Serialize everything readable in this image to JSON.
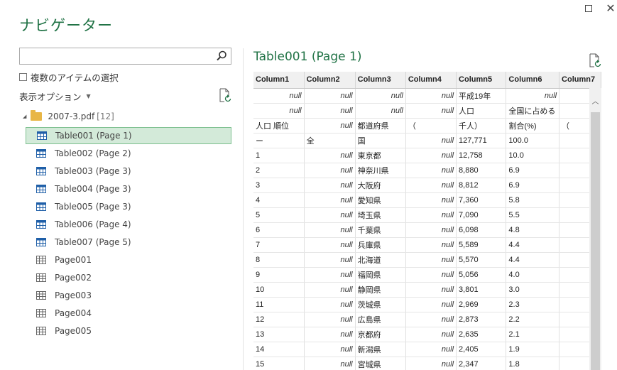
{
  "window": {
    "title": "ナビゲーター",
    "maximize_label": "",
    "close_label": "✕"
  },
  "search": {
    "placeholder": "",
    "value": ""
  },
  "multi_select_label": "複数のアイテムの選択",
  "view_options_label": "表示オプション",
  "tree": {
    "root": {
      "name": "2007-3.pdf",
      "count": "[12]"
    },
    "items": [
      {
        "label": "Table001 (Page 1)",
        "type": "table",
        "selected": true
      },
      {
        "label": "Table002 (Page 2)",
        "type": "table"
      },
      {
        "label": "Table003 (Page 3)",
        "type": "table"
      },
      {
        "label": "Table004 (Page 3)",
        "type": "table"
      },
      {
        "label": "Table005 (Page 3)",
        "type": "table"
      },
      {
        "label": "Table006 (Page 4)",
        "type": "table"
      },
      {
        "label": "Table007 (Page 5)",
        "type": "table"
      },
      {
        "label": "Page001",
        "type": "page"
      },
      {
        "label": "Page002",
        "type": "page"
      },
      {
        "label": "Page003",
        "type": "page"
      },
      {
        "label": "Page004",
        "type": "page"
      },
      {
        "label": "Page005",
        "type": "page"
      }
    ]
  },
  "preview": {
    "title": "Table001 (Page 1)",
    "columns": [
      "Column1",
      "Column2",
      "Column3",
      "Column4",
      "Column5",
      "Column6",
      "Column7"
    ],
    "rows": [
      [
        null,
        null,
        null,
        null,
        "平成19年",
        null,
        ""
      ],
      [
        null,
        null,
        null,
        null,
        "人口",
        "全国に占める",
        ""
      ],
      [
        "人口 順位",
        null,
        "都道府県",
        "（",
        "千人）",
        "割合(%)",
        "（"
      ],
      [
        "ー",
        "全",
        "国",
        null,
        "127,771",
        "100.0",
        ""
      ],
      [
        "1",
        null,
        "東京都",
        null,
        "12,758",
        "10.0",
        ""
      ],
      [
        "2",
        null,
        "神奈川県",
        null,
        "8,880",
        "6.9",
        ""
      ],
      [
        "3",
        null,
        "大阪府",
        null,
        "8,812",
        "6.9",
        ""
      ],
      [
        "4",
        null,
        "愛知県",
        null,
        "7,360",
        "5.8",
        ""
      ],
      [
        "5",
        null,
        "埼玉県",
        null,
        "7,090",
        "5.5",
        ""
      ],
      [
        "6",
        null,
        "千葉県",
        null,
        "6,098",
        "4.8",
        ""
      ],
      [
        "7",
        null,
        "兵庫県",
        null,
        "5,589",
        "4.4",
        ""
      ],
      [
        "8",
        null,
        "北海道",
        null,
        "5,570",
        "4.4",
        ""
      ],
      [
        "9",
        null,
        "福岡県",
        null,
        "5,056",
        "4.0",
        ""
      ],
      [
        "10",
        null,
        "静岡県",
        null,
        "3,801",
        "3.0",
        ""
      ],
      [
        "11",
        null,
        "茨城県",
        null,
        "2,969",
        "2.3",
        ""
      ],
      [
        "12",
        null,
        "広島県",
        null,
        "2,873",
        "2.2",
        ""
      ],
      [
        "13",
        null,
        "京都府",
        null,
        "2,635",
        "2.1",
        ""
      ],
      [
        "14",
        null,
        "新潟県",
        null,
        "2,405",
        "1.9",
        ""
      ],
      [
        "15",
        null,
        "宮城県",
        null,
        "2,347",
        "1.8",
        ""
      ]
    ],
    "null_text": "null"
  },
  "colors": {
    "accent": "#217346",
    "selected_bg": "#d3ead9",
    "selected_border": "#7fc191"
  }
}
